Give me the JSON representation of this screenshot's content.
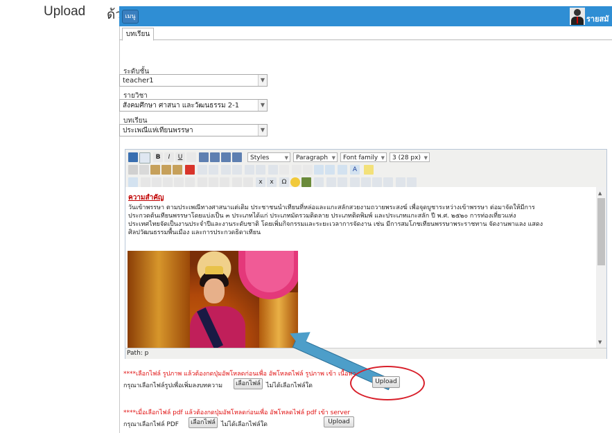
{
  "caption": {
    "upload": "Upload",
    "with": "ด้วย"
  },
  "topbar": {
    "menu_label": "เมนู",
    "username": "รายสมั"
  },
  "tabs": [
    {
      "label": "บทเรียน"
    }
  ],
  "form": {
    "level": {
      "label": "ระดับชั้น",
      "value": "teacher1"
    },
    "subject": {
      "label": "รายวิชา",
      "value": "สังคมศึกษา ศาสนา และวัฒนธรรม 2-1"
    },
    "lesson": {
      "label": "บทเรียน",
      "value": "ประเพณีแห่เทียนพรรษา"
    }
  },
  "editor": {
    "styles": "Styles",
    "paragraph": "Paragraph",
    "font_family": "Font family",
    "font_size": "3 (28 px)",
    "status": "Path: p",
    "heading": "ความสำคัญ",
    "body_lines": [
      "วันเข้าพรรษา ตามประเพณีทางศาสนาแต่เดิม ประชาชนนำเทียนที่หล่อและแกะสลักสวยงามถวายพระสงฆ์ เพื่อจุดบูชาระหว่างเข้าพรรษา ต่อมาจัดให้มีการ",
      "ประกวดต้นเทียนพรรษาโดยแบ่งเป็น ๓ ประเภทได้แก่ ประเภทมัดรวมติดลาย ประเภทติดพิมพ์ และประเภทแกะสลัก ปี พ.ศ. ๒๕๒๐ การท่องเที่ยวแห่ง",
      "ประเทศไทยจัดเป็นงานประจำปีและงานระดับชาติ โดยเพิ่มกิจกรรมและระยะเวลาการจัดงาน เช่น มีการสมโภชเทียนพรรษาพระราชทาน จัดงานพาแลง แสดง",
      "ศิลปวัฒนธรรมพื้นเมือง และการประกวดธิดาเทียน"
    ]
  },
  "image_upload": {
    "warning": "****เลือกไฟล์ รูปภาพ แล้วต้องกดปุ่มอัพโหลดก่อนเพื่อ อัพโหลดไฟล์ รูปภาพ เข้า เนื้อหา",
    "prompt": "กรุณาเลือกไฟล์รูปเพื่อเพิ่มลงบทความ",
    "choose_button": "เลือกไฟล์",
    "no_file": "ไม่ได้เลือกไฟล์ใด",
    "upload_button": "Upload"
  },
  "pdf_upload": {
    "warning": "****เมื่อเลือกไฟล์ pdf แล้วต้องกดปุ่มอัพโหลดก่อนเพื่อ อัพโหลดไฟล์ pdf เข้า server",
    "prompt": "กรุณาเลือกไฟล์ PDF",
    "choose_button": "เลือกไฟล์",
    "no_file": "ไม่ได้เลือกไฟล์ใด",
    "upload_button": "Upload"
  },
  "colors": {
    "topbar": "#2f8ed4",
    "warning": "#e01010",
    "annotation_circle": "#d81f2a",
    "annotation_arrow": "#4d9ec9"
  }
}
